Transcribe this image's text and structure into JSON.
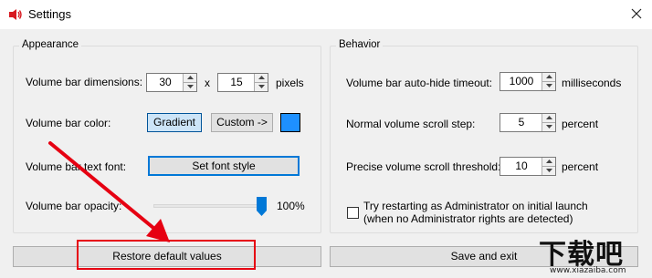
{
  "window": {
    "title": "Settings",
    "close_symbol": "✕"
  },
  "appearance": {
    "legend": "Appearance",
    "dimensions_label": "Volume bar dimensions:",
    "width_value": "30",
    "times_symbol": "x",
    "height_value": "15",
    "pixels_unit": "pixels",
    "color_label": "Volume bar color:",
    "gradient_label": "Gradient",
    "custom_label": "Custom ->",
    "custom_color": "#1e90ff",
    "font_label": "Volume bar text font:",
    "font_button": "Set font style",
    "opacity_label": "Volume bar opacity:",
    "opacity_value": 100,
    "opacity_text": "100%"
  },
  "behavior": {
    "legend": "Behavior",
    "timeout_label": "Volume bar auto-hide timeout:",
    "timeout_value": "1000",
    "timeout_unit": "milliseconds",
    "scroll_label": "Normal volume scroll step:",
    "scroll_value": "5",
    "scroll_unit": "percent",
    "precise_label": "Precise volume scroll threshold:",
    "precise_value": "10",
    "precise_unit": "percent",
    "admin_line1": "Try restarting as Administrator on initial launch",
    "admin_line2": "(when no Administrator rights are detected)",
    "admin_checked": false
  },
  "footer": {
    "restore_label": "Restore default values",
    "save_label": "Save and exit"
  },
  "annotation_color": "#e60012",
  "watermark": {
    "main": "下载吧",
    "sub": "www.xiazaiba.com"
  }
}
